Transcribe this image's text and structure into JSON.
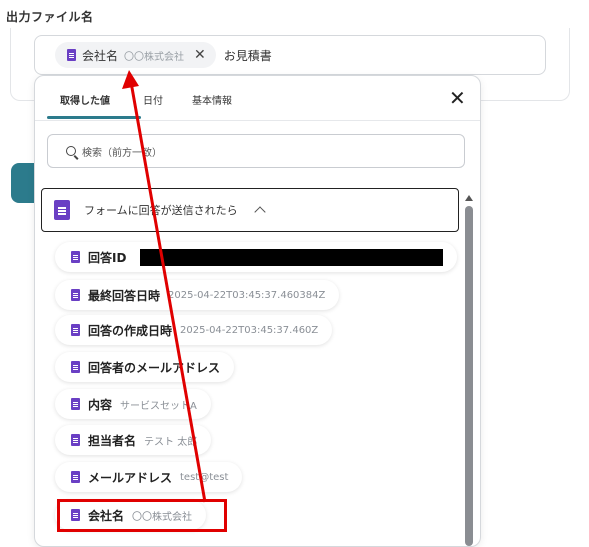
{
  "field": {
    "label": "出力ファイル名"
  },
  "filename": {
    "chip": {
      "label": "会社名",
      "value": "〇〇株式会社"
    },
    "suffix": "お見積書"
  },
  "popup": {
    "tabs": [
      {
        "label": "取得した値"
      },
      {
        "label": "日付"
      },
      {
        "label": "基本情報"
      }
    ],
    "search_placeholder": "検索（前方一致）",
    "section_label": "フォームに回答が送信されたら",
    "items": [
      {
        "label": "回答ID",
        "value": ""
      },
      {
        "label": "最終回答日時",
        "value": "2025-04-22T03:45:37.460384Z"
      },
      {
        "label": "回答の作成日時",
        "value": "2025-04-22T03:45:37.460Z"
      },
      {
        "label": "回答者のメールアドレス",
        "value": ""
      },
      {
        "label": "内容",
        "value": "サービスセットA"
      },
      {
        "label": "担当者名",
        "value": "テスト 太郎"
      },
      {
        "label": "メールアドレス",
        "value": "test@test"
      },
      {
        "label": "会社名",
        "value": "〇〇株式会社"
      }
    ]
  },
  "colors": {
    "accent": "#2c7b8c",
    "doc_icon": "#6a3fc4",
    "annotation": "#e00000"
  }
}
